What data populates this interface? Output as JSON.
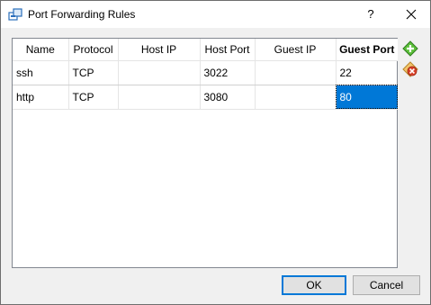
{
  "window": {
    "title": "Port Forwarding Rules",
    "help_label": "?",
    "app_icon": "network-ports-icon",
    "close_icon": "close-icon"
  },
  "table": {
    "columns": [
      "Name",
      "Protocol",
      "Host IP",
      "Host Port",
      "Guest IP",
      "Guest Port"
    ],
    "rows": [
      {
        "name": "ssh",
        "protocol": "TCP",
        "host_ip": "",
        "host_port": "3022",
        "guest_ip": "",
        "guest_port": "22"
      },
      {
        "name": "http",
        "protocol": "TCP",
        "host_ip": "",
        "host_port": "3080",
        "guest_ip": "",
        "guest_port": "80"
      }
    ]
  },
  "side_buttons": {
    "add_icon": "add-rule-icon",
    "remove_icon": "remove-rule-icon"
  },
  "buttons": {
    "ok_label": "OK",
    "cancel_label": "Cancel"
  },
  "colors": {
    "selection": "#0078d7",
    "add_green": "#3ba33b",
    "remove_red": "#d9412a"
  }
}
